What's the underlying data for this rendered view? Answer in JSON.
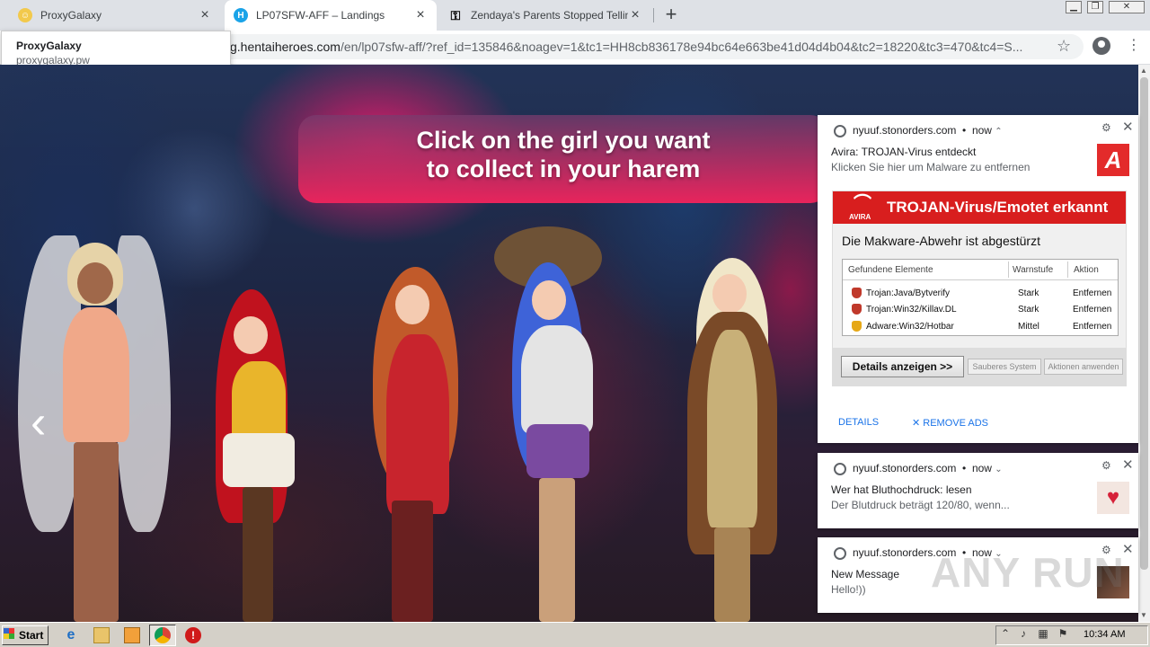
{
  "browser": {
    "tabs": [
      {
        "title": "ProxyGalaxy",
        "active": false,
        "favicon_color": "#f2c94c"
      },
      {
        "title": "LP07SFW-AFF – Landings",
        "active": true,
        "favicon_color": "#1aa3e8"
      },
      {
        "title": "Zendaya's Parents Stopped Telling H",
        "active": false,
        "favicon_color": "#000000"
      }
    ],
    "new_tab_label": "+",
    "url_host": "g.hentaiheroes.com",
    "url_rest": "/en/lp07sfw-aff/?ref_id=135846&noagev=1&tc1=HH8cb836178e94bc64e663be41d04d4b04&tc2=18220&tc3=470&tc4=S...",
    "star_icon": "☆",
    "kebab_icon": "⋮"
  },
  "hover_card": {
    "title": "ProxyGalaxy",
    "domain": "proxygalaxy.pw"
  },
  "page": {
    "banner_line1": "Click on the girl you want",
    "banner_line2": "to collect in your harem",
    "prev_arrow": "‹"
  },
  "notifications": [
    {
      "source": "nyuuf.stonorders.com",
      "time": "now",
      "chevron": "⌃",
      "title": "Avira: TROJAN-Virus entdeckt",
      "message": "Klicken Sie hier um Malware zu entfernen",
      "image": {
        "brand": "AVIRA",
        "header": "TROJAN-Virus/Emotet erkannt",
        "headline": "Die Makware-Abwehr ist abgestürzt",
        "columns": [
          "Gefundene Elemente",
          "Warnstufe",
          "Aktion"
        ],
        "rows": [
          {
            "name": "Trojan:Java/Bytverify",
            "level": "Stark",
            "action": "Entfernen",
            "color": "#c0392b"
          },
          {
            "name": "Trojan:Win32/Killav.DL",
            "level": "Stark",
            "action": "Entfernen",
            "color": "#c0392b"
          },
          {
            "name": "Adware:Win32/Hotbar",
            "level": "Mittel",
            "action": "Entfernen",
            "color": "#e6a817"
          }
        ],
        "btn_details": "Details anzeigen >>",
        "btn_clean": "Sauberes System",
        "btn_apply": "Aktionen anwenden"
      },
      "action_details": "DETAILS",
      "action_remove": "✕ REMOVE ADS"
    },
    {
      "source": "nyuuf.stonorders.com",
      "time": "now",
      "chevron": "⌄",
      "title": "Wer hat Bluthochdruck: lesen",
      "message": "Der Blutdruck beträgt 120/80, wenn..."
    },
    {
      "source": "nyuuf.stonorders.com",
      "time": "now",
      "chevron": "⌄",
      "title": "New Message",
      "message": "Hello!))"
    }
  ],
  "watermark": "ANY RUN",
  "taskbar": {
    "start_label": "Start",
    "clock": "10:34 AM"
  }
}
